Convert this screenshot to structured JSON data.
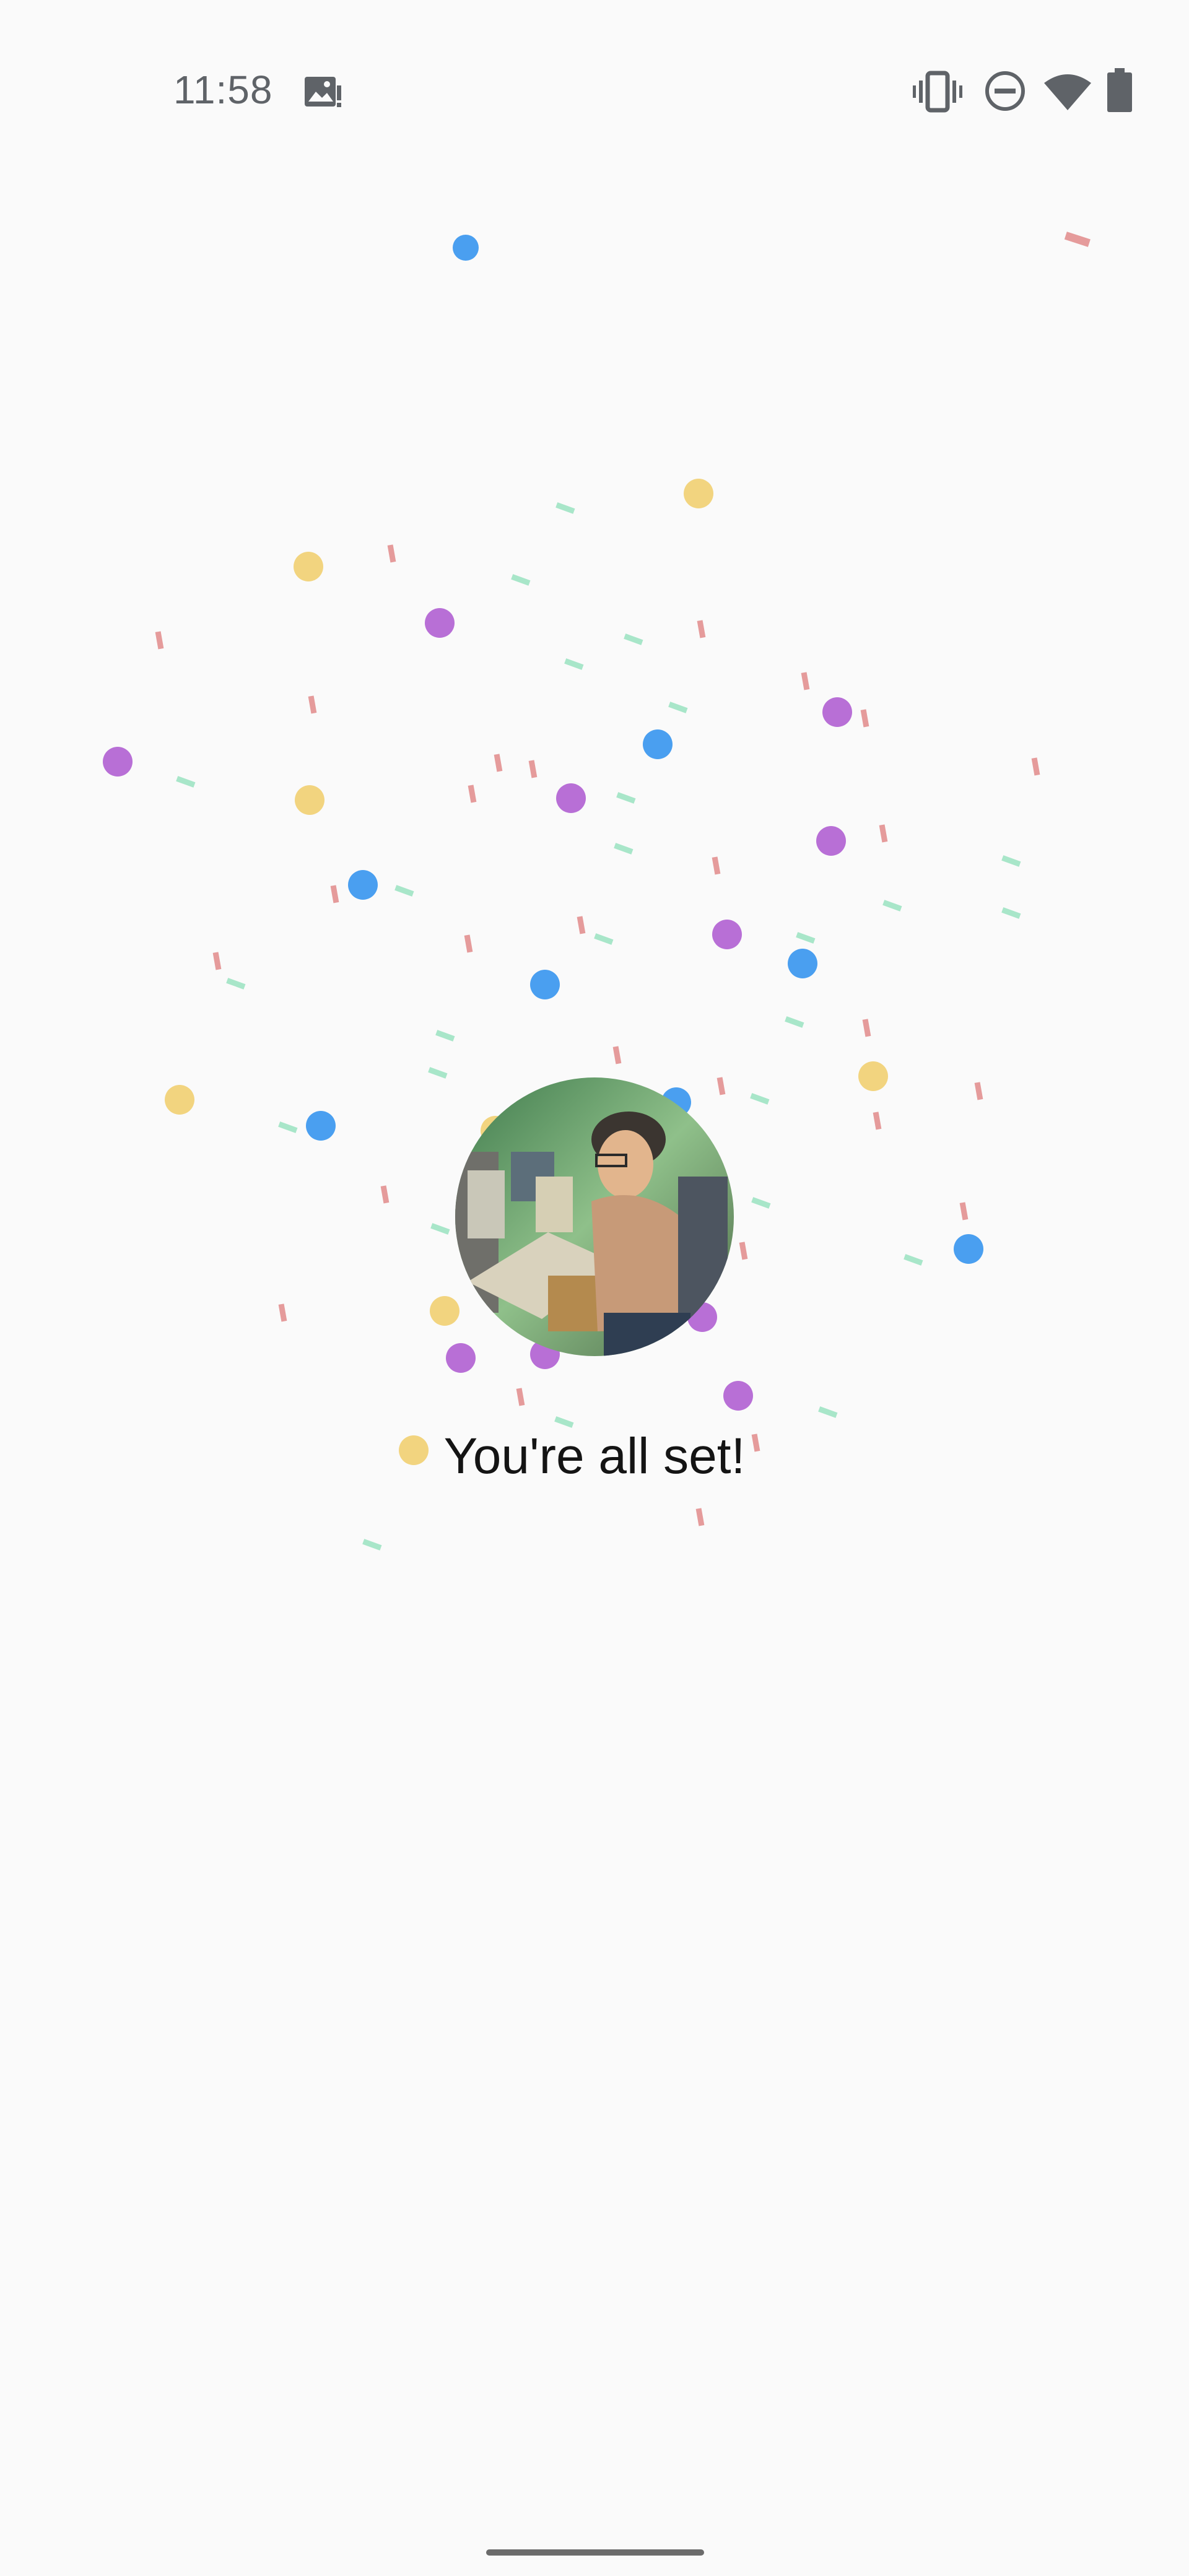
{
  "status_bar": {
    "time": "11:58",
    "icons": [
      "gallery-notification-icon",
      "vibrate-icon",
      "do-not-disturb-icon",
      "wifi-icon",
      "battery-icon"
    ]
  },
  "main": {
    "avatar": "profile-photo",
    "title": "You're all set!"
  },
  "confetti_colors": {
    "blue": "#4a9ff0",
    "purple": "#b86fd6",
    "yellow": "#f2d47f",
    "red": "#e59b9b",
    "green": "#a8e6c9"
  },
  "colors": {
    "background": "#fafafa",
    "status_icon": "#5f6368",
    "title_text": "#141414",
    "home_indicator": "#6b6b6b"
  }
}
